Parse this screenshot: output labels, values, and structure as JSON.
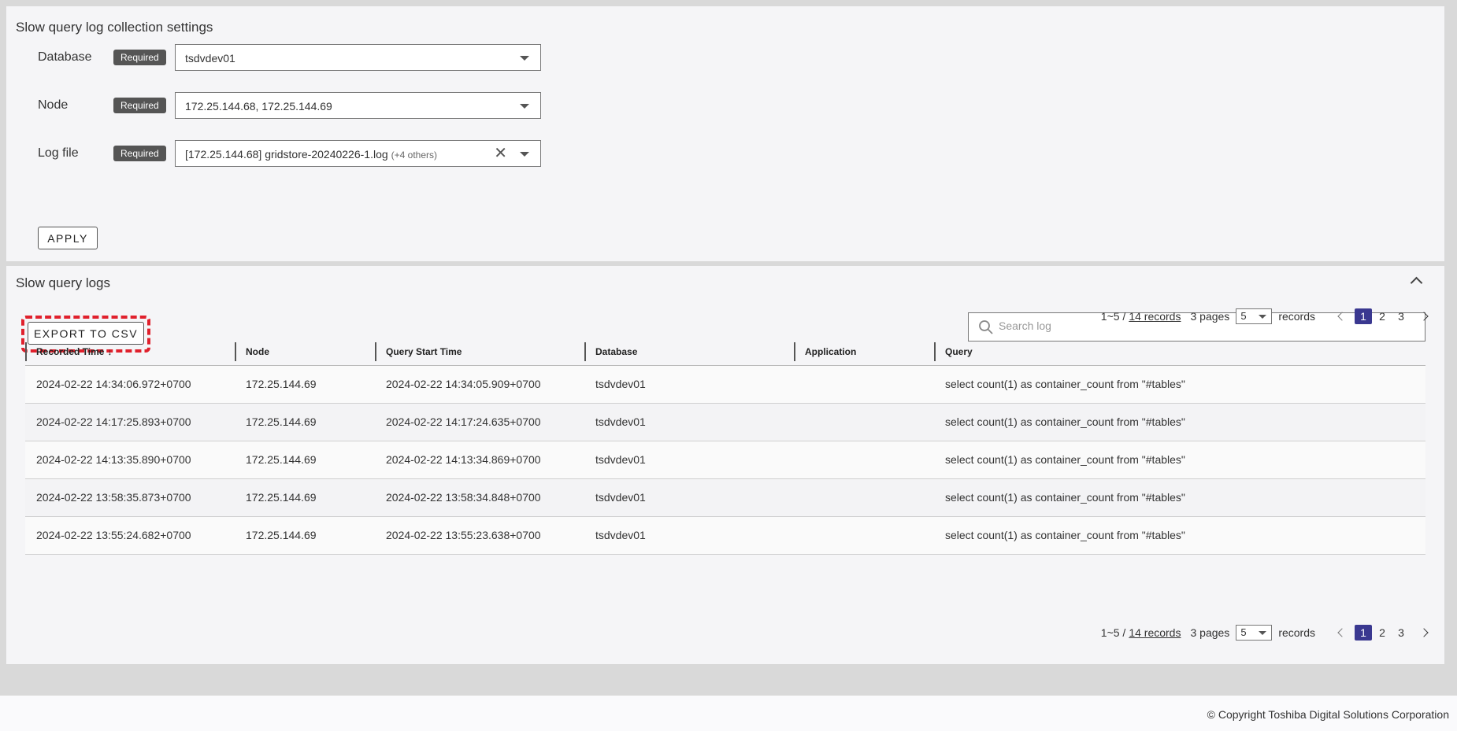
{
  "settings": {
    "title": "Slow query log collection settings",
    "required_label": "Required",
    "database": {
      "label": "Database",
      "value": "tsdvdev01"
    },
    "node": {
      "label": "Node",
      "value": "172.25.144.68, 172.25.144.69"
    },
    "log_file": {
      "label": "Log file",
      "value": "[172.25.144.68] gridstore-20240226-1.log",
      "others": "(+4 others)"
    },
    "apply_label": "APPLY"
  },
  "logs": {
    "title": "Slow query logs",
    "export_label": "EXPORT TO CSV",
    "search_placeholder": "Search log",
    "pagination": {
      "range": "1~5 /",
      "records_link": "14 records",
      "pages": "3 pages",
      "per_page": "5",
      "records_label": "records",
      "page_numbers": [
        "1",
        "2",
        "3"
      ],
      "current_page": "1"
    },
    "columns": [
      "Recorded Time",
      "Node",
      "Query Start Time",
      "Database",
      "Application",
      "Query"
    ],
    "sort_arrow": "↓",
    "rows": [
      {
        "recorded_time": "2024-02-22 14:34:06.972+0700",
        "node": "172.25.144.69",
        "query_start_time": "2024-02-22 14:34:05.909+0700",
        "database": "tsdvdev01",
        "application": "",
        "query": "select count(1) as container_count from \"#tables\""
      },
      {
        "recorded_time": "2024-02-22 14:17:25.893+0700",
        "node": "172.25.144.69",
        "query_start_time": "2024-02-22 14:17:24.635+0700",
        "database": "tsdvdev01",
        "application": "",
        "query": "select count(1) as container_count from \"#tables\""
      },
      {
        "recorded_time": "2024-02-22 14:13:35.890+0700",
        "node": "172.25.144.69",
        "query_start_time": "2024-02-22 14:13:34.869+0700",
        "database": "tsdvdev01",
        "application": "",
        "query": "select count(1) as container_count from \"#tables\""
      },
      {
        "recorded_time": "2024-02-22 13:58:35.873+0700",
        "node": "172.25.144.69",
        "query_start_time": "2024-02-22 13:58:34.848+0700",
        "database": "tsdvdev01",
        "application": "",
        "query": "select count(1) as container_count from \"#tables\""
      },
      {
        "recorded_time": "2024-02-22 13:55:24.682+0700",
        "node": "172.25.144.69",
        "query_start_time": "2024-02-22 13:55:23.638+0700",
        "database": "tsdvdev01",
        "application": "",
        "query": "select count(1) as container_count from \"#tables\""
      }
    ]
  },
  "footer": {
    "copyright": "© Copyright Toshiba Digital Solutions Corporation"
  },
  "icons": {
    "search": "search-icon",
    "clear": "close-icon",
    "dropdown": "chevron-down-icon",
    "collapse": "chevron-up-icon"
  },
  "colors": {
    "active_page": "#3a3890",
    "export_highlight": "#e0202c",
    "badge": "#555555"
  }
}
